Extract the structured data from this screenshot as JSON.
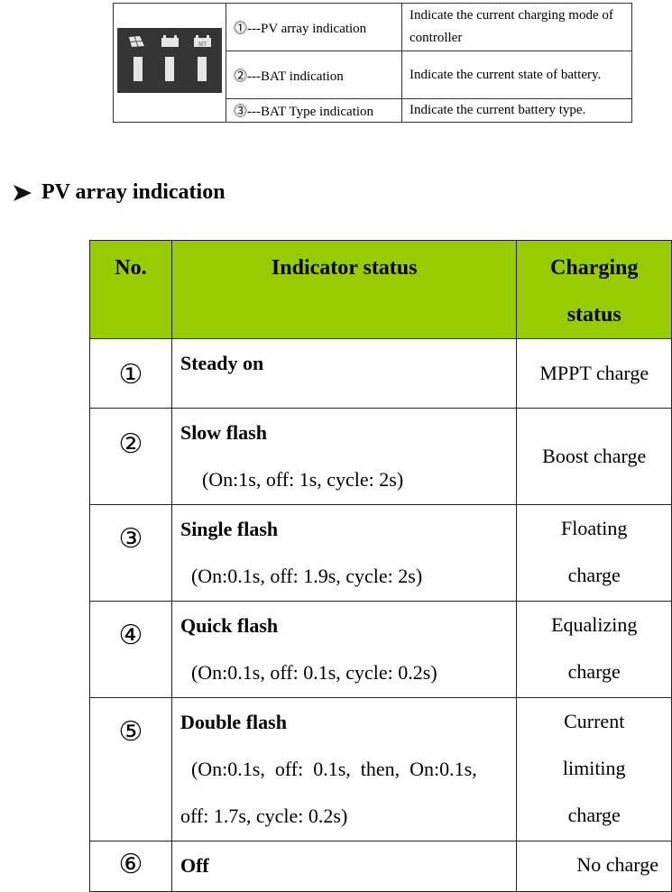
{
  "legend": {
    "rows": [
      {
        "label": "⓵---PV array indication",
        "description": "Indicate the current charging mode of controller"
      },
      {
        "label": "⓶---BAT indication",
        "description": "Indicate the current state of battery."
      },
      {
        "label": "⓷---BAT Type indication",
        "description": "Indicate the current battery type."
      }
    ],
    "panel_icons": [
      "solar-panel-icon",
      "battery-icon",
      "battery-set-icon"
    ],
    "panel_set_text": "SET"
  },
  "section": {
    "heading": "PV array indication",
    "bullet_icon": "arrowhead-icon"
  },
  "table": {
    "header_color": "#99cc00",
    "headers": {
      "no": "No.",
      "indicator": "Indicator status",
      "charging_line1": "Charging",
      "charging_line2": "status"
    },
    "rows": [
      {
        "no": "①",
        "title": "Steady on",
        "detail": "",
        "detail2": "",
        "charging": [
          "MPPT charge"
        ]
      },
      {
        "no": "②",
        "title": "Slow flash",
        "detail": "(On:1s, off: 1s, cycle: 2s)",
        "detail2": "",
        "charging": [
          "Boost charge"
        ]
      },
      {
        "no": "③",
        "title": "Single flash",
        "detail": "(On:0.1s, off: 1.9s, cycle: 2s)",
        "detail2": "",
        "charging": [
          "Floating",
          "charge"
        ]
      },
      {
        "no": "④",
        "title": "Quick flash",
        "detail": "(On:0.1s, off: 0.1s, cycle: 0.2s)",
        "detail2": "",
        "charging": [
          "Equalizing",
          "charge"
        ]
      },
      {
        "no": "⑤",
        "title": "Double flash",
        "detail": "(On:0.1s,  off:  0.1s,  then,  On:0.1s,",
        "detail2": "off: 1.7s, cycle: 0.2s)",
        "charging": [
          "Current",
          "limiting",
          "charge"
        ]
      },
      {
        "no": "⑥",
        "title": "Off",
        "detail": "",
        "detail2": "",
        "charging": [
          "No charge"
        ]
      }
    ]
  }
}
